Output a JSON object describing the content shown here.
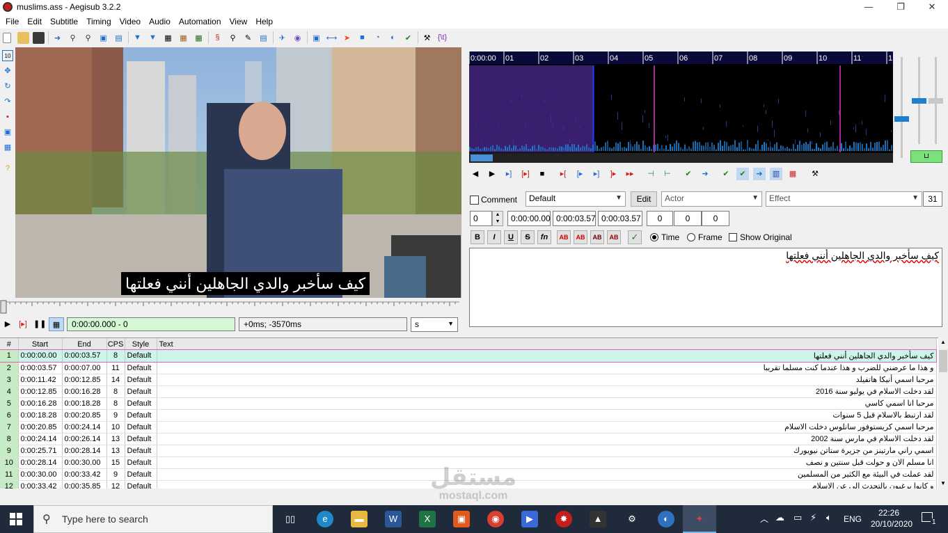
{
  "window": {
    "title": "muslims.ass - Aegisub 3.2.2",
    "minimize_glyph": "—",
    "restore_glyph": "❐",
    "close_glyph": "✕"
  },
  "menu": [
    "File",
    "Edit",
    "Subtitle",
    "Timing",
    "Video",
    "Audio",
    "Automation",
    "View",
    "Help"
  ],
  "video": {
    "subtitle_text": "كيف سأخبر والدي الجاهلين أنني فعلتها"
  },
  "video_controls": {
    "time": "0:00:00.000 - 0",
    "offset": "+0ms; -3570ms",
    "zoom": "s"
  },
  "audio": {
    "ruler_labels": [
      "0:00:00",
      "01",
      "02",
      "03",
      "04",
      "05",
      "06",
      "07",
      "08",
      "09",
      "10",
      "11",
      "1"
    ],
    "selection_start_seconds": 0,
    "selection_end_seconds": 3.57,
    "colors": {
      "selection": "#3a1f6e",
      "waveform": "#1e7fd0",
      "marker": "#d838c8"
    }
  },
  "edit": {
    "comment_label": "Comment",
    "style": "Default",
    "edit_button": "Edit",
    "actor_placeholder": "Actor",
    "effect_placeholder": "Effect",
    "char_count": "31",
    "layer": "0",
    "start_time": "0:00:00.00",
    "end_time": "0:00:03.57",
    "duration": "0:00:03.57",
    "margin_l": "0",
    "margin_r": "0",
    "margin_v": "0",
    "format_buttons": [
      "B",
      "I",
      "U",
      "S",
      "fn",
      "AB",
      "AB",
      "AB",
      "AB"
    ],
    "commit_glyph": "✓",
    "time_label": "Time",
    "frame_label": "Frame",
    "show_original_label": "Show Original",
    "text": "كيف سأخبر والدي الجاهلين أنني فعلتها"
  },
  "grid": {
    "headers": [
      "#",
      "Start",
      "End",
      "CPS",
      "Style",
      "Text"
    ],
    "rows": [
      {
        "n": "1",
        "start": "0:00:00.00",
        "end": "0:00:03.57",
        "cps": "8",
        "style": "Default",
        "text": "كيف سأخبر والدي الجاهلين أنني فعلتها"
      },
      {
        "n": "2",
        "start": "0:00:03.57",
        "end": "0:00:07.00",
        "cps": "11",
        "style": "Default",
        "text": "و هذا ما عرضني للضرب و هذا عندما كنت مسلما تقريبا"
      },
      {
        "n": "3",
        "start": "0:00:11.42",
        "end": "0:00:12.85",
        "cps": "14",
        "style": "Default",
        "text": "مرحبا اسمي أنيكا هاتفيلد"
      },
      {
        "n": "4",
        "start": "0:00:12.85",
        "end": "0:00:16.28",
        "cps": "8",
        "style": "Default",
        "text": "لقد دخلت الاسلام في يوليو سنة 2016"
      },
      {
        "n": "5",
        "start": "0:00:16.28",
        "end": "0:00:18.28",
        "cps": "8",
        "style": "Default",
        "text": "مرحبا انا اسمي كاسي"
      },
      {
        "n": "6",
        "start": "0:00:18.28",
        "end": "0:00:20.85",
        "cps": "9",
        "style": "Default",
        "text": "لقد ارتبط بالاسلام قبل 5 سنوات"
      },
      {
        "n": "7",
        "start": "0:00:20.85",
        "end": "0:00:24.14",
        "cps": "10",
        "style": "Default",
        "text": "مرحبا اسمي كريستوفور سانلوس دخلت الاسلام"
      },
      {
        "n": "8",
        "start": "0:00:24.14",
        "end": "0:00:26.14",
        "cps": "13",
        "style": "Default",
        "text": "لقد دخلت الاسلام في مارس سنة 2002"
      },
      {
        "n": "9",
        "start": "0:00:25.71",
        "end": "0:00:28.14",
        "cps": "13",
        "style": "Default",
        "text": "اسمي راني مارتينز من جزيرة ستاتن نيويورك"
      },
      {
        "n": "10",
        "start": "0:00:28.14",
        "end": "0:00:30.00",
        "cps": "15",
        "style": "Default",
        "text": "انا مسلم الان و حولت قبل سنتين و نصف"
      },
      {
        "n": "11",
        "start": "0:00:30.00",
        "end": "0:00:33.42",
        "cps": "9",
        "style": "Default",
        "text": "لقد عملت في البيئة مع الكثير من المسلمين"
      },
      {
        "n": "12",
        "start": "0:00:33.42",
        "end": "0:00:35.85",
        "cps": "12",
        "style": "Default",
        "text": "و كانوا يرغبون بالتحدث الي عن الاسلام"
      }
    ]
  },
  "watermark": {
    "text": "مستقل",
    "sub": "mostaql.com"
  },
  "taskbar": {
    "search_placeholder": "Type here to search",
    "language": "ENG",
    "time": "22:26",
    "date": "20/10/2020",
    "notification_count": "1"
  }
}
